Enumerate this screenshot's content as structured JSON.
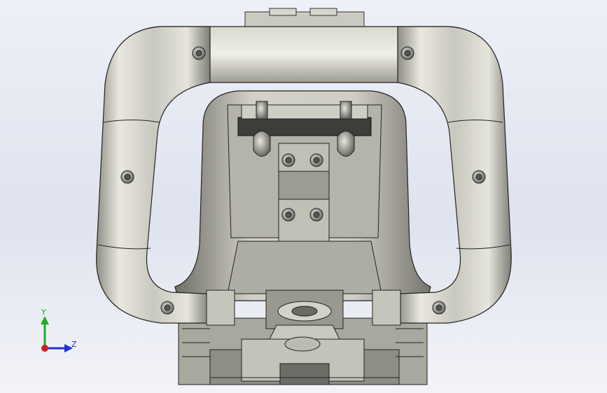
{
  "viewport": {
    "background_top": "#eef0f7",
    "background_bottom": "#f3f4f9"
  },
  "model": {
    "description_icon": "3d-cad-model",
    "material_color": "#b9b8ae",
    "edge_color": "#222222"
  },
  "triad": {
    "y_label": "Y",
    "z_label": "Z",
    "y_color": "#22aa22",
    "z_color": "#2233cc",
    "x_color": "#cc2222"
  }
}
